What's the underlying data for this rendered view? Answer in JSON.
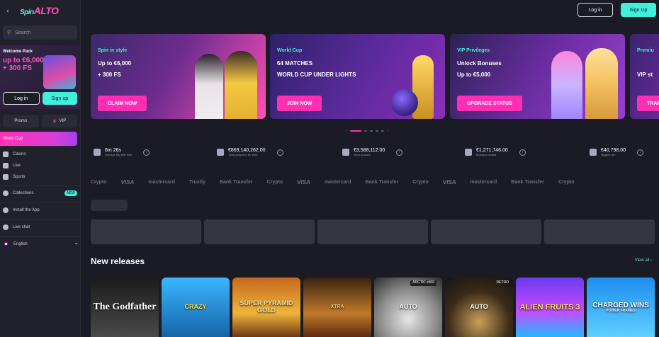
{
  "brand": {
    "spin": "Spin",
    "alto": "ALTO"
  },
  "header": {
    "login": "Log in",
    "signup": "Sign Up"
  },
  "sidebar": {
    "search_placeholder": "Search",
    "welcome": {
      "title": "Welcome Pack",
      "line1": "up to €6,000",
      "line2": "+ 300 FS",
      "login": "Log in",
      "signup": "Sign up"
    },
    "promo": "Promo",
    "vip": "VIP",
    "world_cup": "World Cup",
    "nav": [
      "Casino",
      "Live",
      "Sports"
    ],
    "collections": "Collections",
    "collections_badge": "NEW",
    "install": "Install the App",
    "livechat": "Live chat",
    "language": "English"
  },
  "banners": [
    {
      "eyebrow": "Spin in style",
      "line1": "Up to €6,000",
      "line2": "+ 300 FS",
      "cta": "CLAIM NOW"
    },
    {
      "eyebrow": "World Cup",
      "line1": "64 MATCHES",
      "line2": "WORLD CUP UNDER LIGHTS",
      "cta": "JOIN NOW"
    },
    {
      "eyebrow": "VIP Privileges",
      "line1": "Unlock Bonuses",
      "line2": "Up to €5,000",
      "cta": "UPGRADE STATUS"
    },
    {
      "eyebrow": "Premiu",
      "line1": "",
      "line2": "VIP st",
      "cta": "TRAN"
    }
  ],
  "stats": [
    {
      "value": "6m 26s",
      "label": "Average Big Win time"
    },
    {
      "value": "€869,140,262.00",
      "label": "Total jackpot to be Won"
    },
    {
      "value": "€3,588,112.00",
      "label": "Wins Amount"
    },
    {
      "value": "€1,271,746.00",
      "label": "Bonuses issued"
    },
    {
      "value": "€40,798.00",
      "label": "Biggest win"
    }
  ],
  "payments": [
    "Crypto",
    "VISA",
    "mastercard",
    "Trustly",
    "Bank Transfer",
    "Crypto",
    "VISA",
    "mastercard",
    "Bank Transfer",
    "Crypto",
    "VISA",
    "mastercard",
    "Bank Transfer",
    "Crypto"
  ],
  "new_releases": {
    "title": "New releases",
    "view_all": "View all ›"
  },
  "games": [
    {
      "label": "The Godfather"
    },
    {
      "label": "CRAZY"
    },
    {
      "label": "SUPER PYRAMID GOLD"
    },
    {
      "label": "XTRA"
    },
    {
      "label": "AUTO",
      "tag": "ARCTIC x500"
    },
    {
      "label": "AUTO",
      "tag": "RETRO"
    },
    {
      "label": "ALIEN FRUITS 3"
    },
    {
      "label": "CHARGED WINS",
      "sub": "POWER FRAMES"
    }
  ]
}
